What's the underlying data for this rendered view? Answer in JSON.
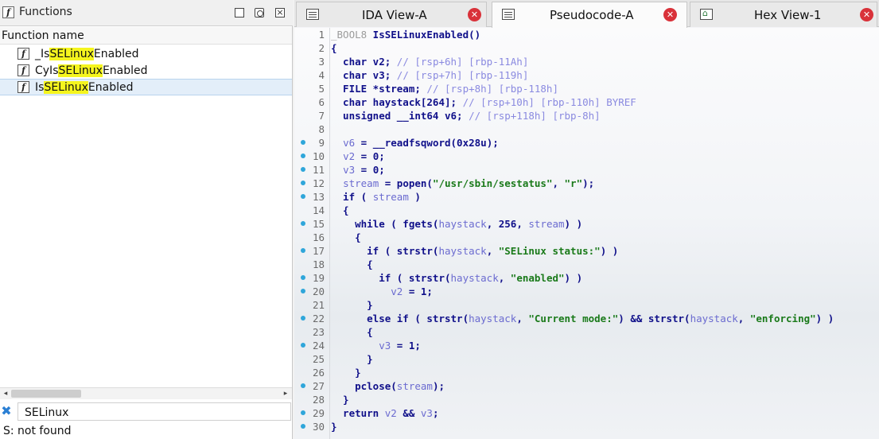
{
  "left_panel": {
    "title": "Functions",
    "column_header": "Function name",
    "functions": [
      {
        "prefix": "_Is",
        "match": "SELinux",
        "suffix": "Enabled",
        "selected": false
      },
      {
        "prefix": "CyIs",
        "match": "SELinux",
        "suffix": "Enabled",
        "selected": false
      },
      {
        "prefix": "Is",
        "match": "SELinux",
        "suffix": "Enabled",
        "selected": true
      }
    ],
    "search_value": "SELinux",
    "status": "S: not found"
  },
  "tabs": [
    {
      "label": "IDA View-A",
      "icon": "list-icon",
      "active": false
    },
    {
      "label": "Pseudocode-A",
      "icon": "list-icon",
      "active": true
    },
    {
      "label": "Hex View-1",
      "icon": "hex-icon",
      "active": false
    }
  ],
  "code": {
    "lines": [
      {
        "n": "1",
        "dot": false,
        "html": "<span class='gr'>_BOOL8</span> IsSELinuxEnabled()"
      },
      {
        "n": "2",
        "dot": false,
        "html": "{"
      },
      {
        "n": "3",
        "dot": false,
        "html": "  char v2; <span class='cm'>// [rsp+6h] [rbp-11Ah]</span>"
      },
      {
        "n": "4",
        "dot": false,
        "html": "  char v3; <span class='cm'>// [rsp+7h] [rbp-119h]</span>"
      },
      {
        "n": "5",
        "dot": false,
        "html": "  FILE *stream; <span class='cm'>// [rsp+8h] [rbp-118h]</span>"
      },
      {
        "n": "6",
        "dot": false,
        "html": "  char haystack[264]; <span class='cm'>// [rsp+10h] [rbp-110h] BYREF</span>"
      },
      {
        "n": "7",
        "dot": false,
        "html": "  unsigned __int64 v6; <span class='cm'>// [rsp+118h] [rbp-8h]</span>"
      },
      {
        "n": "8",
        "dot": false,
        "html": ""
      },
      {
        "n": "9",
        "dot": true,
        "html": "  <span class='va'>v6</span> = __readfsqword(0x28u);"
      },
      {
        "n": "10",
        "dot": true,
        "html": "  <span class='va'>v2</span> = 0;"
      },
      {
        "n": "11",
        "dot": true,
        "html": "  <span class='va'>v3</span> = 0;"
      },
      {
        "n": "12",
        "dot": true,
        "html": "  <span class='va'>stream</span> = popen(<span class='st'>\"/usr/sbin/sestatus\"</span>, <span class='st'>\"r\"</span>);"
      },
      {
        "n": "13",
        "dot": true,
        "html": "  if ( <span class='va'>stream</span> )"
      },
      {
        "n": "14",
        "dot": false,
        "html": "  {"
      },
      {
        "n": "15",
        "dot": true,
        "html": "    while ( fgets(<span class='va'>haystack</span>, 256, <span class='va'>stream</span>) )"
      },
      {
        "n": "16",
        "dot": false,
        "html": "    {"
      },
      {
        "n": "17",
        "dot": true,
        "html": "      if ( strstr(<span class='va'>haystack</span>, <span class='st'>\"SELinux status:\"</span>) )"
      },
      {
        "n": "18",
        "dot": false,
        "html": "      {"
      },
      {
        "n": "19",
        "dot": true,
        "html": "        if ( strstr(<span class='va'>haystack</span>, <span class='st'>\"enabled\"</span>) )"
      },
      {
        "n": "20",
        "dot": true,
        "html": "          <span class='va'>v2</span> = 1;"
      },
      {
        "n": "21",
        "dot": false,
        "html": "      }"
      },
      {
        "n": "22",
        "dot": true,
        "html": "      else if ( strstr(<span class='va'>haystack</span>, <span class='st'>\"Current mode:\"</span>) &amp;&amp; strstr(<span class='va'>haystack</span>, <span class='st'>\"enforcing\"</span>) )"
      },
      {
        "n": "23",
        "dot": false,
        "html": "      {"
      },
      {
        "n": "24",
        "dot": true,
        "html": "        <span class='va'>v3</span> = 1;"
      },
      {
        "n": "25",
        "dot": false,
        "html": "      }"
      },
      {
        "n": "26",
        "dot": false,
        "html": "    }"
      },
      {
        "n": "27",
        "dot": true,
        "html": "    pclose(<span class='va'>stream</span>);"
      },
      {
        "n": "28",
        "dot": false,
        "html": "  }"
      },
      {
        "n": "29",
        "dot": true,
        "html": "  return <span class='va'>v2</span> &amp;&amp; <span class='va'>v3</span>;"
      },
      {
        "n": "30",
        "dot": true,
        "html": "}"
      }
    ]
  },
  "colors": {
    "accent_dot": "#2fa6da",
    "close_red": "#d9323a",
    "match_highlight": "#f5f51e"
  }
}
